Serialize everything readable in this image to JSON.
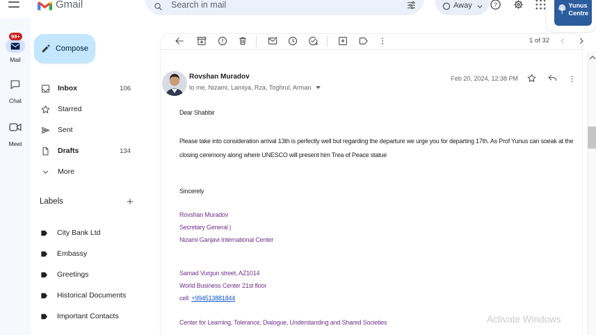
{
  "header": {
    "app_name": "Gmail",
    "search_placeholder": "Search in mail",
    "status_label": "Away",
    "yunus_line1": "Yunus",
    "yunus_line2": "Centre"
  },
  "rail": {
    "mail": {
      "label": "Mail",
      "badge": "99+"
    },
    "chat": {
      "label": "Chat"
    },
    "meet": {
      "label": "Meet"
    }
  },
  "sidebar": {
    "compose_label": "Compose",
    "nav": [
      {
        "label": "Inbox",
        "count": "106"
      },
      {
        "label": "Starred",
        "count": ""
      },
      {
        "label": "Sent",
        "count": ""
      },
      {
        "label": "Drafts",
        "count": "134"
      },
      {
        "label": "More",
        "count": ""
      }
    ],
    "labels_header": "Labels",
    "labels": [
      {
        "name": "City Bank Ltd"
      },
      {
        "name": "Embassy"
      },
      {
        "name": "Greetings"
      },
      {
        "name": "Historical Documents"
      },
      {
        "name": "Important Contacts"
      }
    ]
  },
  "toolbar": {
    "pagination": "1 of 32"
  },
  "email": {
    "sender": "Rovshan Muradov",
    "recipients": "to me, Nizami, Lamiya, Rza, Toghrul, Arman",
    "date": "Feb 20, 2024, 12:38 PM",
    "greeting": "Dear Shabbir",
    "body_line1": "Please take into consideration arrival 13th is perfectly well but regarding the departure we urge you for departing 17th. As Prof Yunus can soeak at the",
    "body_line2": "closing ceremony along where UNESCO will present him Trea of Peace statue",
    "closing": "Sincerely",
    "signature": {
      "name": "Rovshan Muradov",
      "title": "Secretary General |",
      "organization": "Nizami Ganjavi International Center",
      "address_line1": "Samad Vurgun street, AZ1014",
      "address_line2": "World Business Center 21st floor",
      "cell_label": "cell: ",
      "cell_number": "+994513881844",
      "tagline": "Center for Learning, Tolerance, Dialogue, Understanding and Shared Societies"
    }
  },
  "watermark": "Activate Windows",
  "colors": {
    "brand_blue": "#4285f4",
    "brand_red": "#ea4335",
    "brand_yellow": "#fbbc04",
    "brand_green": "#34a853",
    "compose_bg": "#c2e7ff",
    "selected_pill": "#d3e3fd",
    "badge_red": "#c5221f",
    "signature_purple": "#71338b",
    "link_blue": "#1155cc",
    "yunus_blue": "#2b5c9d"
  }
}
